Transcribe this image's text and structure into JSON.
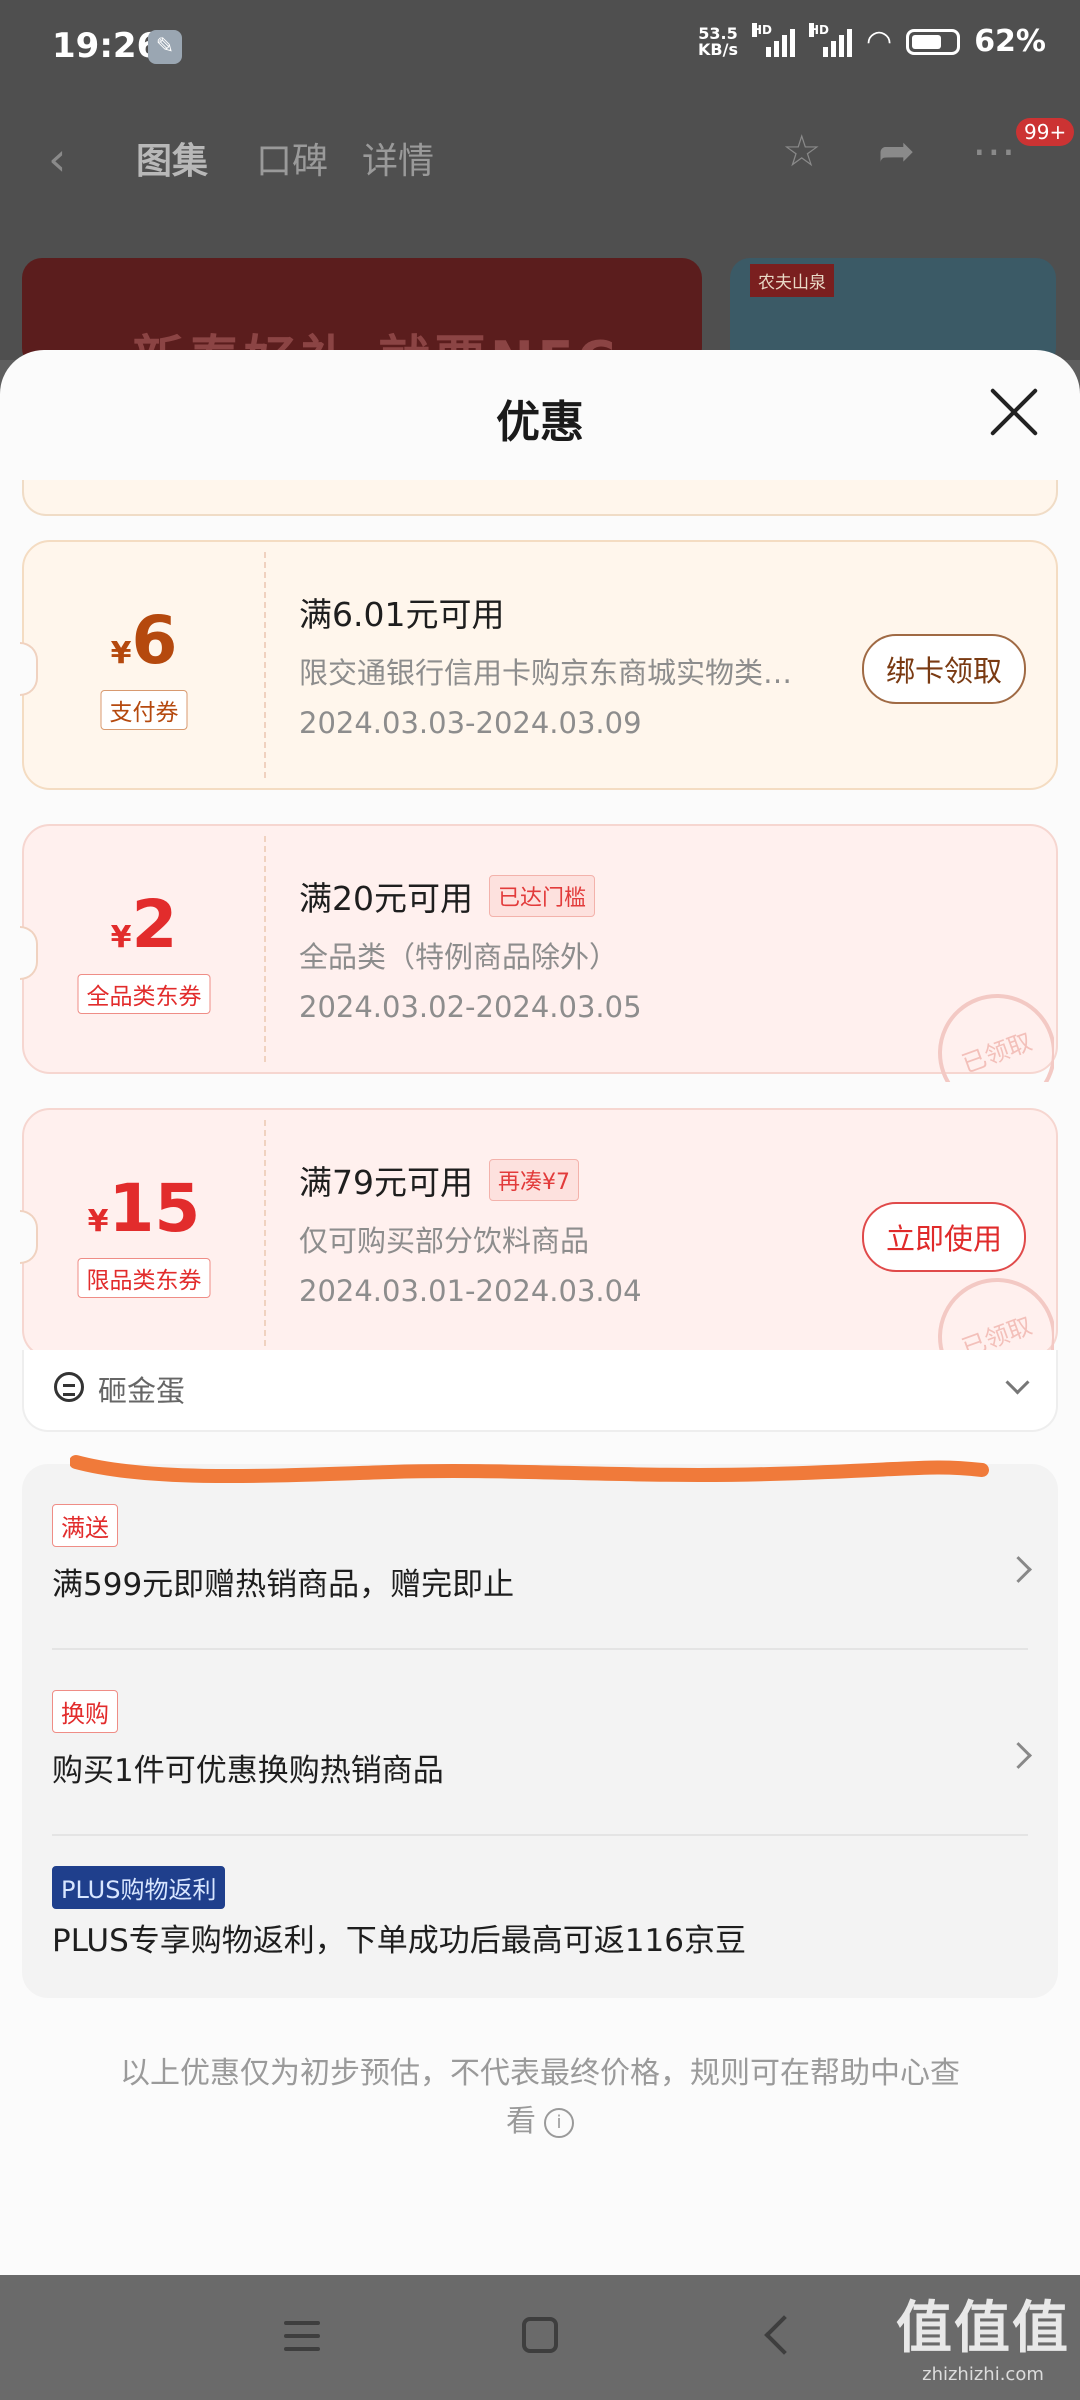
{
  "status_bar": {
    "time": "19:26",
    "net_speed_value": "53.5",
    "net_speed_unit": "KB/s",
    "sig1_label": "HD",
    "sig2_label": "HD",
    "battery": "62%"
  },
  "top_nav": {
    "tabs": [
      "图集",
      "口碑",
      "详情"
    ],
    "badge": "99+"
  },
  "banners": {
    "left_text": "新春好礼 就要NFC",
    "right_logo": "农夫山泉"
  },
  "sheet": {
    "title": "优惠"
  },
  "coupons": [
    {
      "yen": "¥",
      "amount": "6",
      "type": "支付券",
      "condition": "满6.01元可用",
      "tag": "",
      "description": "限交通银行信用卡购京东商城实物类…",
      "date_range": "2024.03.03-2024.03.09",
      "button": "绑卡领取",
      "stamp": ""
    },
    {
      "yen": "¥",
      "amount": "2",
      "type": "全品类东券",
      "condition": "满20元可用",
      "tag": "已达门槛",
      "description": "全品类（特例商品除外）",
      "date_range": "2024.03.02-2024.03.05",
      "button": "",
      "stamp": "已领取"
    },
    {
      "yen": "¥",
      "amount": "15",
      "type": "限品类东券",
      "condition": "满79元可用",
      "tag": "再凑¥7",
      "description": "仅可购买部分饮料商品",
      "date_range": "2024.03.01-2024.03.04",
      "button": "立即使用",
      "stamp": "已领取"
    }
  ],
  "egg_row": {
    "label": "砸金蛋"
  },
  "promotions": [
    {
      "tag": "满送",
      "text": "满599元即赠热销商品，赠完即止"
    },
    {
      "tag": "换购",
      "text": "购买1件可优惠换购热销商品"
    },
    {
      "tag": "PLUS购物返利",
      "text": "PLUS专享购物返利，下单成功后最高可返116京豆"
    }
  ],
  "disclaimer": {
    "text": "以上优惠仅为初步预估，不代表最终价格，规则可在帮助中心查看",
    "icon": "i"
  },
  "watermark": {
    "big": "值值值",
    "small": "zhizhizhi.com"
  },
  "colors": {
    "coupon_orange": "#b5490e",
    "coupon_red": "#e22c2c",
    "scribble": "#f07a3a"
  }
}
